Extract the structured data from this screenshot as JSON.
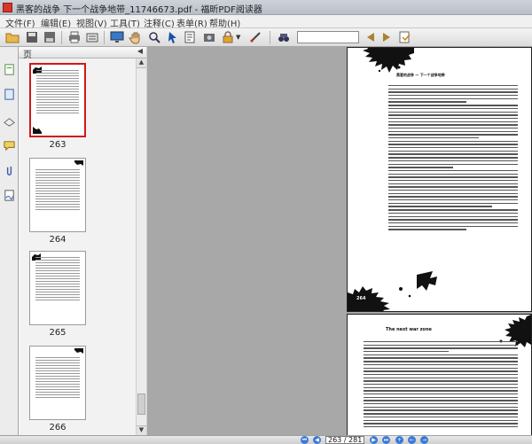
{
  "window": {
    "title": "黑客的战争   下一个战争地带_11746673.pdf - 福昕PDF阅读器"
  },
  "menu": {
    "items": [
      "文件(F)",
      "编辑(E)",
      "视图(V)",
      "工具(T)",
      "注释(C)",
      "表单(R)",
      "帮助(H)"
    ]
  },
  "toolbar": {
    "search_value": ""
  },
  "panel": {
    "title": "页",
    "thumbnails": [
      {
        "page": "263",
        "selected": true
      },
      {
        "page": "264",
        "selected": false
      },
      {
        "page": "265",
        "selected": false
      },
      {
        "page": "266",
        "selected": false
      }
    ]
  },
  "document": {
    "page1_head": "黑客的战争 — 下一个战争地带",
    "page1_number": "264",
    "page2_head": "The next war zone"
  },
  "status": {
    "page_indicator": "263 / 281"
  },
  "colors": {
    "selection_border": "#d01818",
    "nav_button": "#3a7ad8"
  }
}
